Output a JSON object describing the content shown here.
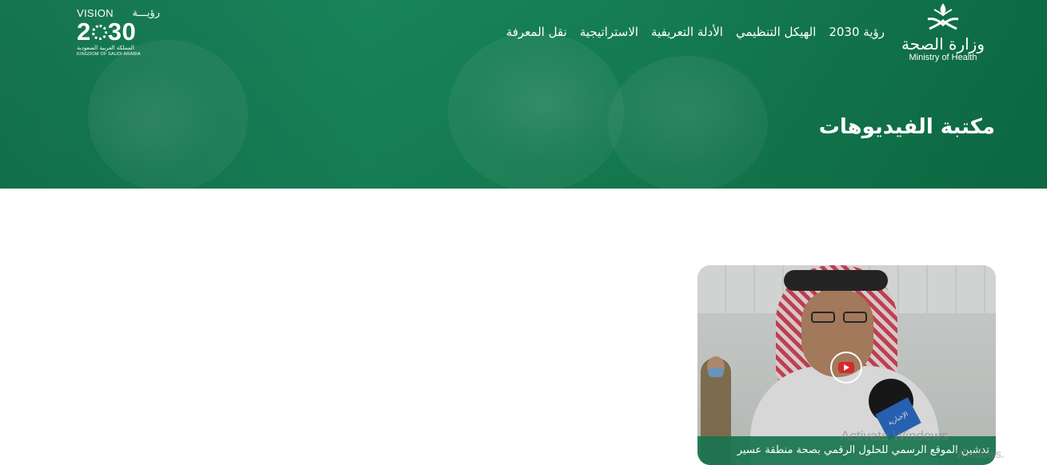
{
  "header": {
    "moh_logo": {
      "arabic_name": "وزارة الصحة",
      "english_name": "Ministry of Health",
      "icon": "moh-emblem-icon"
    },
    "vision_logo": {
      "vision_en": "VISION",
      "vision_ar": "رؤيـــة",
      "year_prefix": "2",
      "year_suffix": "30",
      "kingdom_ar": "المملكة العربية السعودية",
      "kingdom_en": "KINGDOM OF SAUDI ARABIA"
    },
    "nav": [
      {
        "label": "رؤية 2030"
      },
      {
        "label": "الهيكل التنظيمي"
      },
      {
        "label": "الأدلة التعريفية"
      },
      {
        "label": "الاستراتيجية"
      },
      {
        "label": "نقل المعرفة"
      }
    ]
  },
  "hero": {
    "title": "مكتبة الفيديوهات"
  },
  "videos": [
    {
      "caption": "تدشين الموقع الرسمي للحلول الرقمي بصحة منطقة عسير",
      "play_icon": "play-icon",
      "mic_label": "الإخبارية"
    }
  ],
  "watermark": {
    "title": "Activate Windows",
    "subtitle": "Windows."
  },
  "colors": {
    "brand_green": "#178457",
    "caption_green": "#18744e",
    "play_red": "#d8282d"
  }
}
